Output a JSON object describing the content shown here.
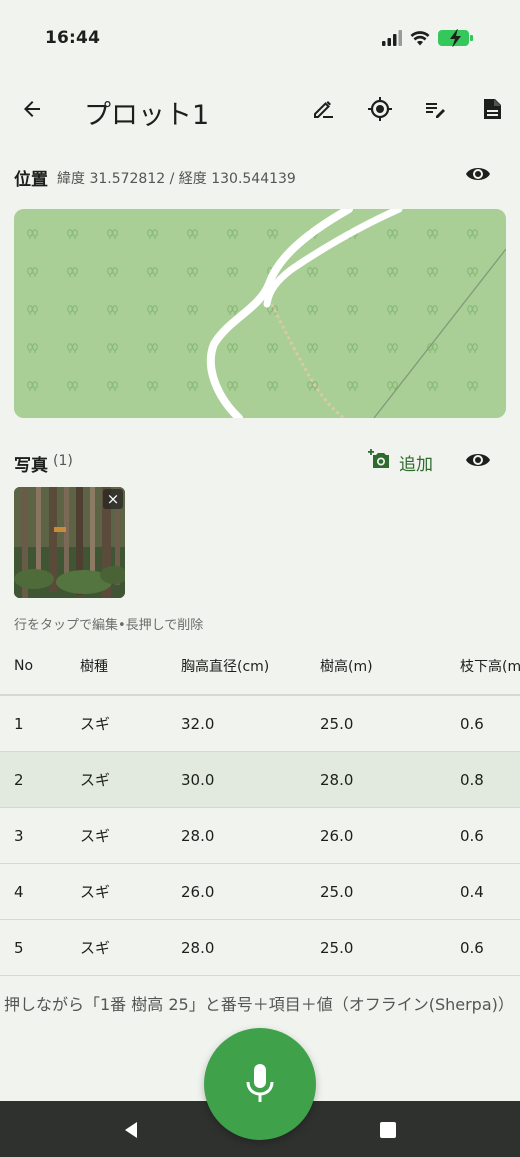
{
  "status": {
    "time": "16:44"
  },
  "appbar": {
    "title": "プロット1",
    "icons": [
      "back-arrow-icon",
      "edit-pencil-icon",
      "gps-target-icon",
      "edit-note-icon",
      "save-file-icon"
    ]
  },
  "location": {
    "label": "位置",
    "coords": "緯度 31.572812 / 経度 130.544139"
  },
  "photos": {
    "label": "写真",
    "count": "(1)",
    "add_label": "追加",
    "close": "×"
  },
  "table": {
    "hint": "行をタップで編集•長押しで削除",
    "columns": [
      "No",
      "樹種",
      "胸高直径(cm)",
      "樹高(m)",
      "枝下高(m"
    ],
    "rows": [
      [
        "1",
        "スギ",
        "32.0",
        "25.0",
        "0.6"
      ],
      [
        "2",
        "スギ",
        "30.0",
        "28.0",
        "0.8"
      ],
      [
        "3",
        "スギ",
        "28.0",
        "26.0",
        "0.6"
      ],
      [
        "4",
        "スギ",
        "26.0",
        "25.0",
        "0.4"
      ],
      [
        "5",
        "スギ",
        "28.0",
        "25.0",
        "0.6"
      ]
    ],
    "selected_row": 2
  },
  "voice": {
    "hint": "押しながら「1番 樹高 25」と番号＋項目＋値（オフライン(Sherpa)）"
  },
  "colors": {
    "background": "#f1f4ee",
    "accent": "#3fa24b",
    "map_green": "#a9cf96",
    "add_green": "#2f6b2e"
  }
}
